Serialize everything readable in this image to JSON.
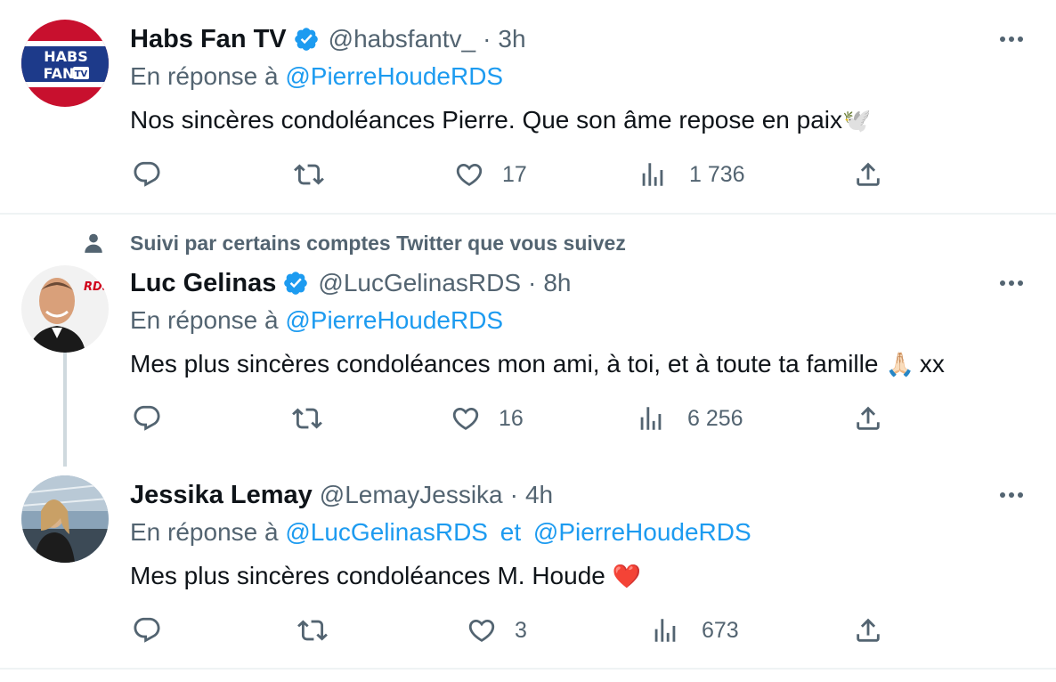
{
  "tweets": [
    {
      "name": "Habs Fan TV",
      "verified": true,
      "handle": "@habsfantv_",
      "sep": "·",
      "time": "3h",
      "reply_prefix": "En réponse à",
      "reply_mentions": [
        "@PierreHoudeRDS"
      ],
      "text": "Nos sincères condoléances Pierre. Que son âme repose en paix",
      "emoji": "🕊️",
      "likes": "17",
      "views": "1 736",
      "avatar_text": [
        "HABS",
        "FAN",
        "TV"
      ]
    },
    {
      "social_context": "Suivi par certains comptes Twitter que vous suivez",
      "name": "Luc Gelinas",
      "verified": true,
      "handle": "@LucGelinasRDS",
      "sep": "·",
      "time": "8h",
      "reply_prefix": "En réponse à",
      "reply_mentions": [
        "@PierreHoudeRDS"
      ],
      "text": "Mes plus sincères condoléances mon ami, à toi, et à toute ta famille",
      "emoji": "🙏🏻",
      "text_suffix": "xx",
      "likes": "16",
      "views": "6 256",
      "avatar_text": "RDS"
    },
    {
      "name": "Jessika Lemay",
      "verified": false,
      "handle": "@LemayJessika",
      "sep": "·",
      "time": "4h",
      "reply_prefix": "En réponse à",
      "reply_mentions": [
        "@LucGelinasRDS",
        "@PierreHoudeRDS"
      ],
      "reply_joiner": "et",
      "text": "Mes plus sincères condoléances M. Houde",
      "emoji": "❤️",
      "likes": "3",
      "views": "673"
    }
  ],
  "colors": {
    "text": "#0f1419",
    "secondary": "#536471",
    "link": "#1d9bf0",
    "verified": "#1d9bf0",
    "divider": "#eff3f4",
    "thread_line": "#cfd9de",
    "heart": "#e0245e"
  },
  "icons": [
    "reply-icon",
    "retweet-icon",
    "like-icon",
    "views-icon",
    "share-icon",
    "more-icon",
    "verified-icon",
    "person-icon"
  ]
}
